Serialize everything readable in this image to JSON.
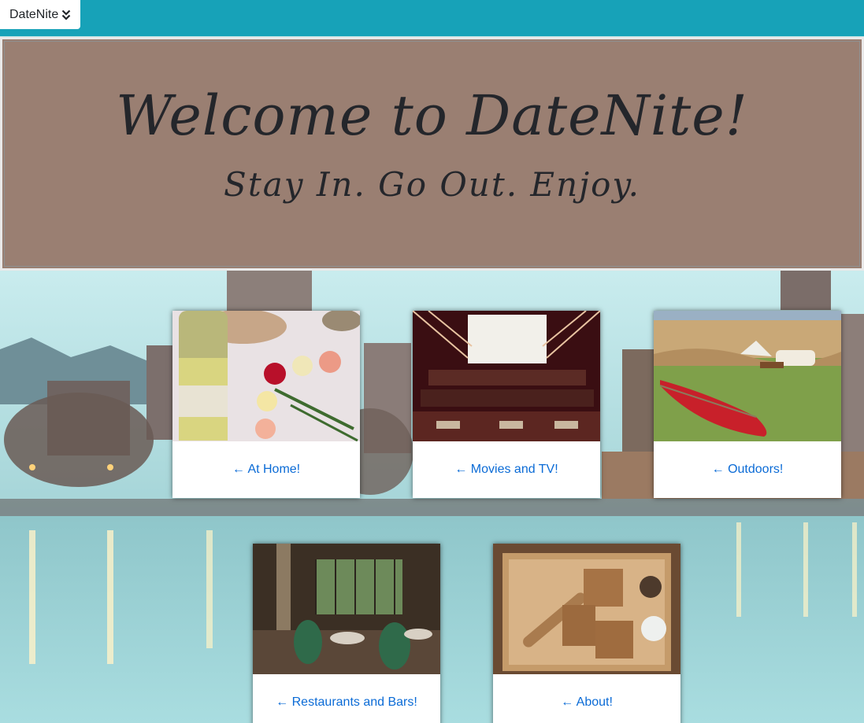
{
  "nav": {
    "brand_label": "DateNite",
    "brand_icon": "chevron-double-down-icon"
  },
  "hero": {
    "title": "Welcome to DateNite!",
    "subtitle": "Stay In. Go Out. Enjoy."
  },
  "cards": {
    "home": {
      "label": "← At Home!",
      "image": "wine-bottle-and-roses-photo"
    },
    "movies": {
      "label": "← Movies and TV!",
      "image": "movie-theater-photo"
    },
    "outdoors": {
      "label": "← Outdoors!",
      "image": "canoe-picnic-photo"
    },
    "restaurants": {
      "label": "← Restaurants and Bars!",
      "image": "restaurant-interior-photo"
    },
    "about": {
      "label": "← About!",
      "image": "baking-tray-photo"
    }
  },
  "colors": {
    "navbar": "#17a2b8",
    "hero_bg": "#9a7f72",
    "link": "#0b6bd6",
    "text_dark": "#24262b"
  }
}
